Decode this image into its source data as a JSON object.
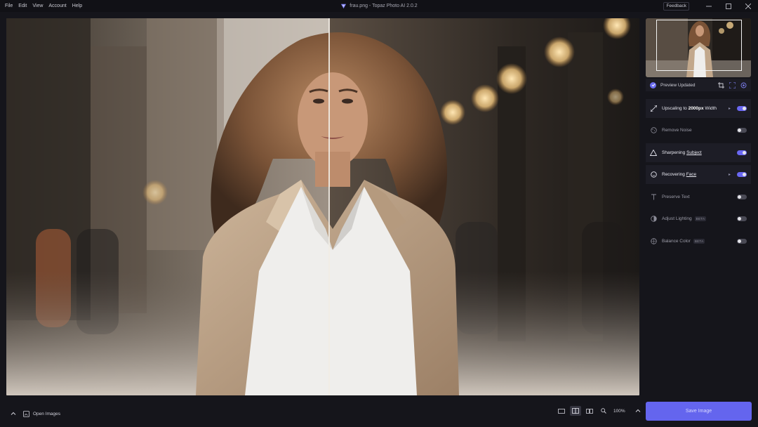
{
  "menu": [
    "File",
    "Edit",
    "View",
    "Account",
    "Help"
  ],
  "window": {
    "title": "frau.png - Topaz Photo AI 2.0.2",
    "feedback_label": "Feedback"
  },
  "preview": {
    "status_label": "Preview Updated"
  },
  "features": [
    {
      "prefix": "Upscaling to ",
      "bold": "2000px",
      "suffix": " Width",
      "beta": "",
      "enabled": true,
      "expandable": true,
      "icon": "expand-arrows-icon"
    },
    {
      "prefix": "Remove Noise",
      "bold": "",
      "suffix": "",
      "beta": "",
      "enabled": false,
      "expandable": false,
      "icon": "noise-icon"
    },
    {
      "prefix": "Sharpening ",
      "bold": "",
      "underline": "Subject",
      "suffix": "",
      "beta": "",
      "enabled": true,
      "expandable": false,
      "icon": "triangle-icon"
    },
    {
      "prefix": "Recovering ",
      "bold": "",
      "underline": "Face",
      "suffix": "",
      "beta": "",
      "enabled": true,
      "expandable": true,
      "icon": "face-icon"
    },
    {
      "prefix": "Preserve Text",
      "bold": "",
      "suffix": "",
      "beta": "",
      "enabled": false,
      "expandable": false,
      "icon": "text-icon"
    },
    {
      "prefix": "Adjust Lighting",
      "bold": "",
      "suffix": "",
      "beta": "BETA",
      "enabled": false,
      "expandable": false,
      "icon": "lighting-icon"
    },
    {
      "prefix": "Balance Color",
      "bold": "",
      "suffix": "",
      "beta": "BETA",
      "enabled": false,
      "expandable": false,
      "icon": "color-icon"
    }
  ],
  "bottombar": {
    "open_images_label": "Open Images",
    "zoom_label": "100%",
    "save_label": "Save Image"
  },
  "colors": {
    "accent": "#6465ee",
    "background": "#15151b"
  }
}
